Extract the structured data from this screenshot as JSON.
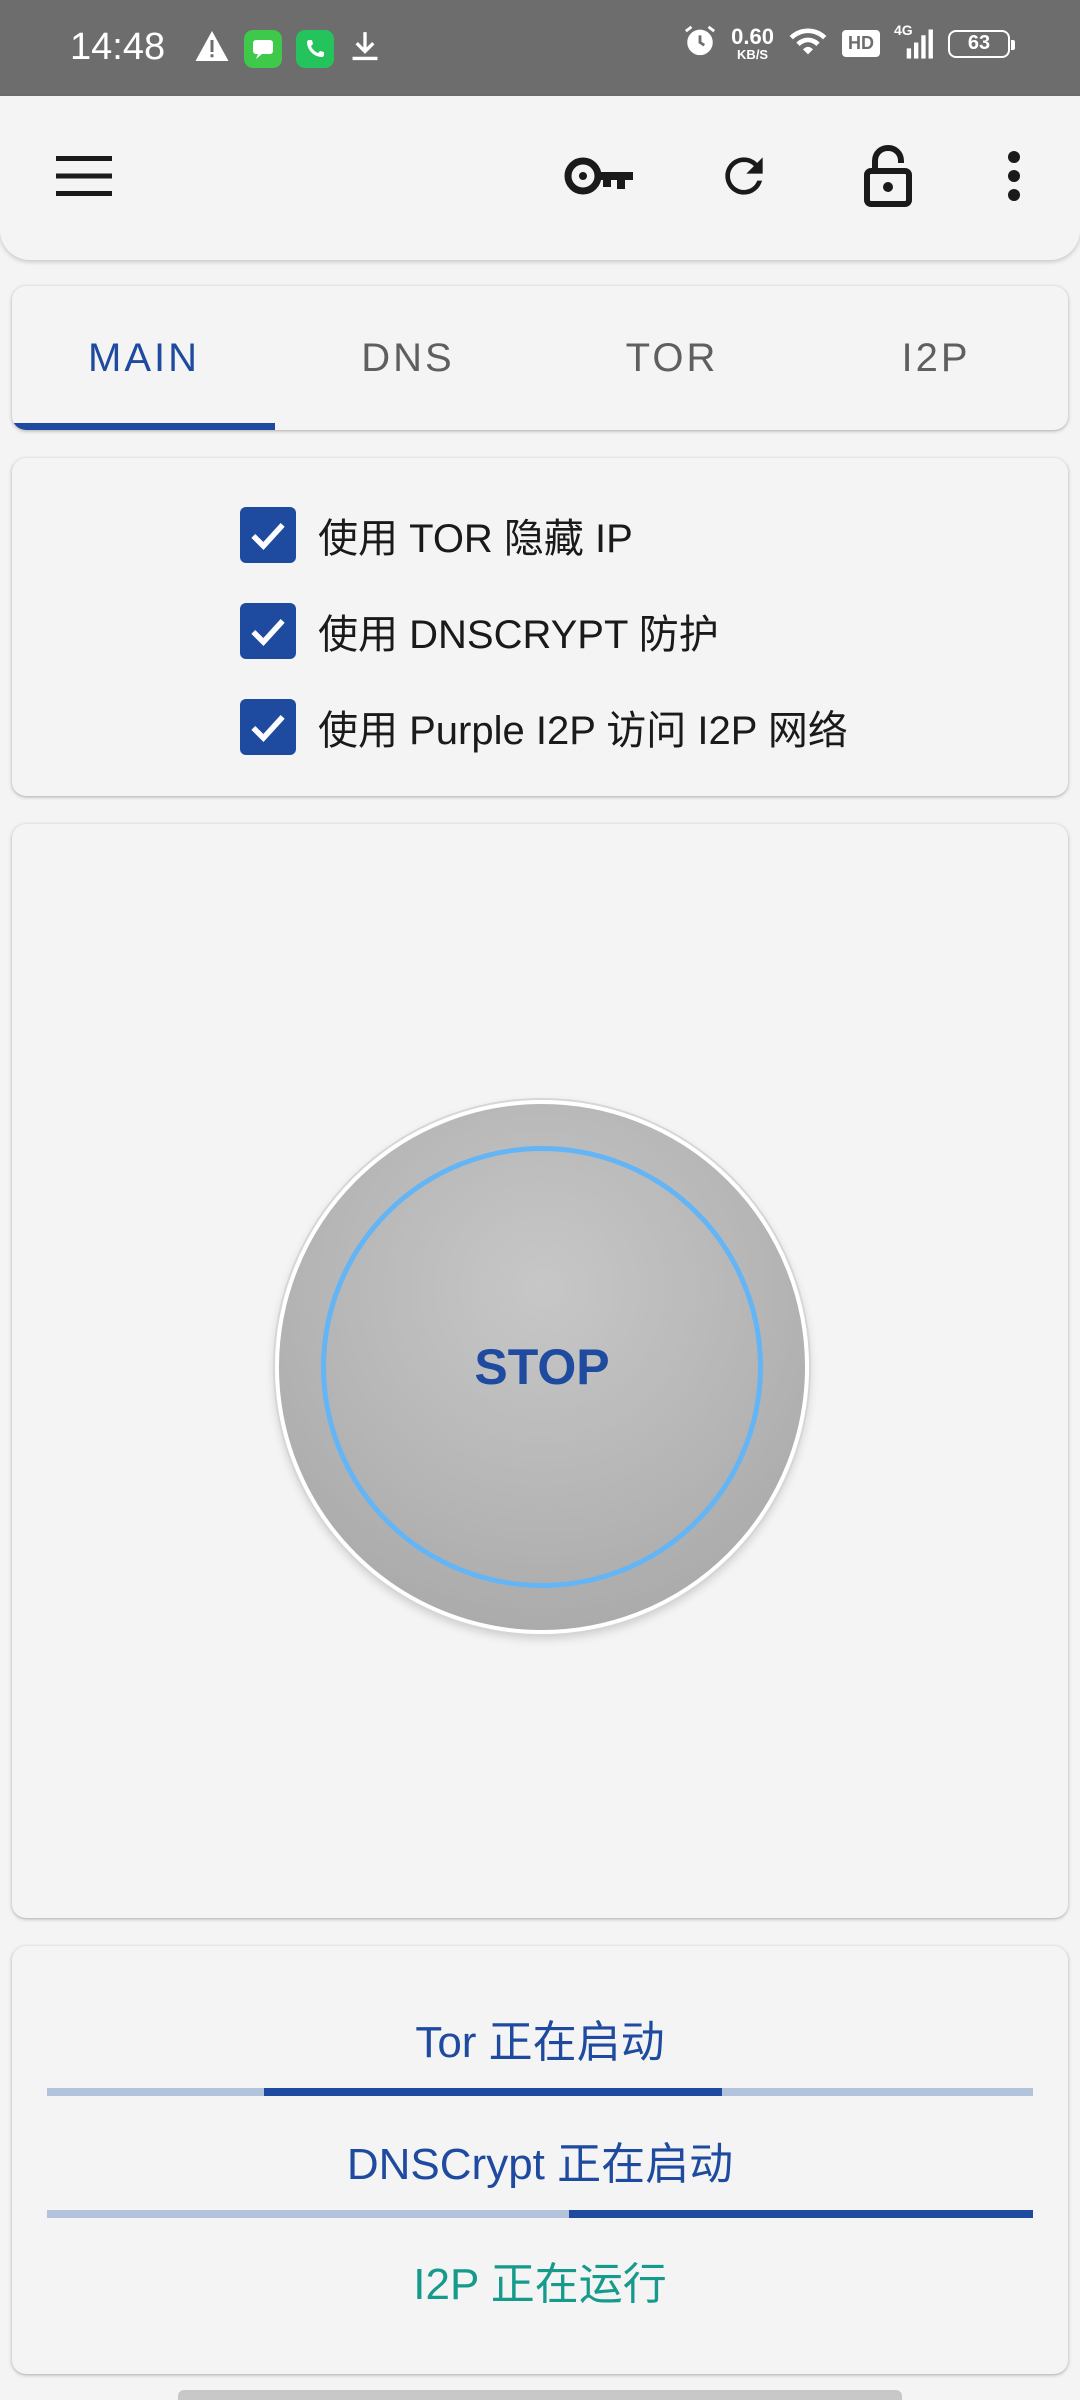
{
  "status_bar": {
    "time": "14:48",
    "net_speed_value": "0.60",
    "net_speed_unit": "KB/S",
    "hd_label": "HD",
    "network_label": "4G",
    "battery": "63",
    "icons": [
      "warning-icon",
      "messages-app-icon",
      "phone-app-icon",
      "download-icon",
      "alarm-icon",
      "wifi-icon",
      "signal-icon"
    ]
  },
  "toolbar": {
    "icons": [
      "menu-icon",
      "key-icon",
      "refresh-icon",
      "lock-icon",
      "more-vert-icon"
    ]
  },
  "tabs": [
    {
      "label": "MAIN",
      "active": true
    },
    {
      "label": "DNS",
      "active": false
    },
    {
      "label": "TOR",
      "active": false
    },
    {
      "label": "I2P",
      "active": false
    }
  ],
  "options": [
    {
      "label": "使用 TOR 隐藏 IP",
      "checked": true
    },
    {
      "label": "使用 DNSCRYPT 防护",
      "checked": true
    },
    {
      "label": "使用 Purple I2P 访问 I2P 网络",
      "checked": true
    }
  ],
  "main_button": {
    "label": "STOP"
  },
  "services": [
    {
      "status": "Tor 正在启动",
      "color": "#1e4a9f",
      "progress_indicator": "indeterminate"
    },
    {
      "status": "DNSCrypt 正在启动",
      "color": "#1e4a9f",
      "progress_indicator": "indeterminate"
    },
    {
      "status": "I2P 正在运行",
      "color": "#159a8c"
    }
  ],
  "colors": {
    "accent": "#1e4a9f",
    "running": "#159a8c",
    "ring": "#64b5f6",
    "status_bar": "#6d6d6d"
  }
}
